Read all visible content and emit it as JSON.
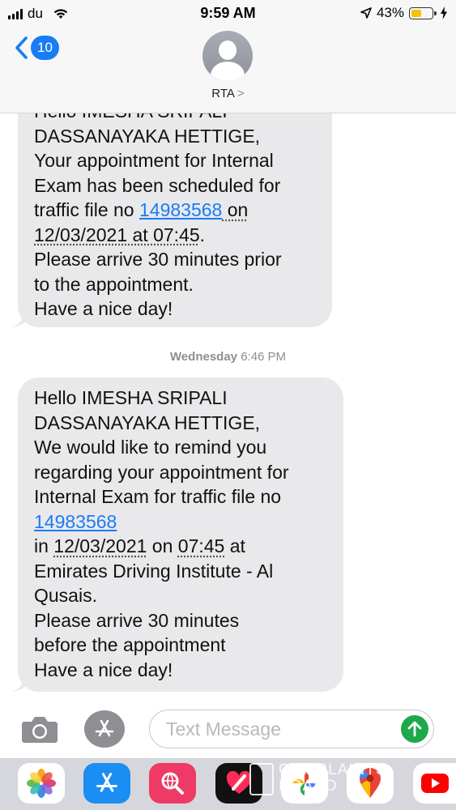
{
  "status_bar": {
    "carrier": "du",
    "time": "9:59 AM",
    "battery_percent": "43%",
    "battery_level": 0.43,
    "battery_color": "#f5c400"
  },
  "nav": {
    "back_count": "10",
    "contact_name": "RTA",
    "chevron": ">"
  },
  "messages": [
    {
      "lines": [
        "Hello IMESHA SRIPALI",
        "DASSANAYAKA HETTIGE,",
        "Your appointment for Internal",
        "Exam has been scheduled for",
        "traffic file no ",
        "14983568",
        " on",
        "12/03/2021 at 07:45",
        ".",
        "Please arrive 30 minutes prior",
        "to the appointment.",
        "Have a nice day!"
      ]
    },
    {
      "timestamp_day": "Wednesday",
      "timestamp_time": "6:46 PM",
      "lines": [
        "Hello IMESHA SRIPALI",
        "DASSANAYAKA HETTIGE,",
        "We would like to remind you",
        "regarding your appointment for",
        "Internal Exam for traffic file no",
        "14983568",
        "in ",
        "12/03/2021",
        " on ",
        "07:45",
        " at",
        "Emirates Driving Institute - Al",
        "Qusais.",
        "Please arrive 30 minutes",
        "before the appointment",
        "Have a nice day!"
      ]
    }
  ],
  "input": {
    "placeholder": "Text Message"
  },
  "tray": {
    "apps": [
      "photos-icon",
      "app-store-icon",
      "web-search-icon",
      "digital-touch-icon",
      "google-photos-icon",
      "google-maps-icon",
      "youtube-icon"
    ]
  },
  "watermark": {
    "line1": "COMPLAINTS",
    "line2": "BOARD"
  },
  "colors": {
    "bubble_bg": "#e9e9eb",
    "link": "#1a7cf5",
    "send_button": "#1ea84a",
    "tray_bg": "#d6d7dc"
  }
}
